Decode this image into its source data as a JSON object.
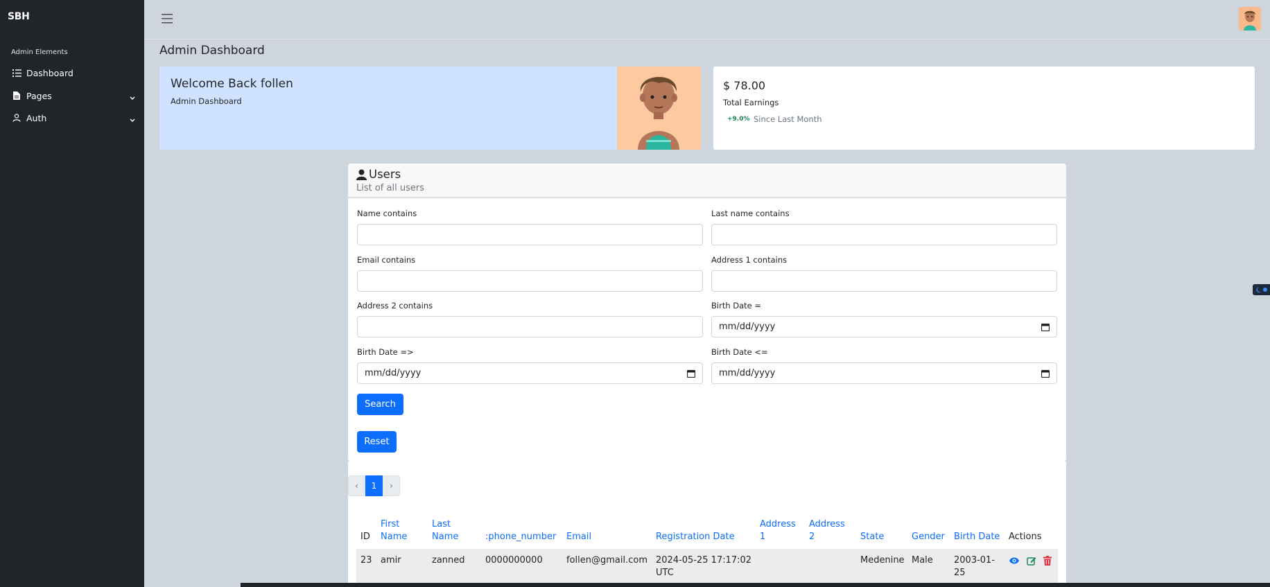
{
  "sidebar": {
    "brand": "SBH",
    "heading": "Admin Elements",
    "items": [
      {
        "label": "Dashboard",
        "icon": "list-icon"
      },
      {
        "label": "Pages",
        "icon": "file-icon"
      },
      {
        "label": "Auth",
        "icon": "user-icon"
      }
    ]
  },
  "header": {
    "page_title": "Admin Dashboard"
  },
  "welcome": {
    "title": "Welcome Back follen",
    "subtitle": "Admin Dashboard"
  },
  "earnings": {
    "amount": "$ 78.00",
    "label": "Total Earnings",
    "badge": "+9.0%",
    "since": "Since Last Month",
    "badge_color": "#198754"
  },
  "users": {
    "title": "Users",
    "subtitle": "List of all users",
    "filters": {
      "name_label": "Name contains",
      "lastname_label": "Last name contains",
      "email_label": "Email contains",
      "address1_label": "Address 1 contains",
      "address2_label": "Address 2 contains",
      "birth_eq_label": "Birth Date =",
      "birth_gte_label": "Birth Date =>",
      "birth_lte_label": "Birth Date <=",
      "date_placeholder": "mm/dd/yyyy"
    },
    "search_label": "Search",
    "reset_label": "Reset"
  },
  "pagination": {
    "prev": "‹",
    "current": "1",
    "next": "›"
  },
  "table": {
    "headers": {
      "id": "ID",
      "first_name": [
        "First",
        "Name"
      ],
      "last_name": [
        "Last",
        "Name"
      ],
      "phone": ":phone_number",
      "email": "Email",
      "registration": "Registration Date",
      "address1": [
        "Address",
        "1"
      ],
      "address2": [
        "Address",
        "2"
      ],
      "state": "State",
      "gender": "Gender",
      "birth": "Birth Date",
      "actions": "Actions"
    },
    "rows": [
      {
        "id": "23",
        "first_name": "amir",
        "last_name": "zanned",
        "phone": "0000000000",
        "email": "follen@gmail.com",
        "registration": [
          "2024-05-25 17:17:02",
          "UTC"
        ],
        "address1": "",
        "address2": "",
        "state": "Medenine",
        "gender": "Male",
        "birth": [
          "2003-01-",
          "25"
        ]
      }
    ]
  },
  "colors": {
    "primary": "#0d6efd",
    "sidebar_bg": "#212529",
    "page_bg": "#cfd5dd",
    "welcome_bg": "#cfe2ff",
    "danger": "#dc3545",
    "success": "#198754"
  }
}
